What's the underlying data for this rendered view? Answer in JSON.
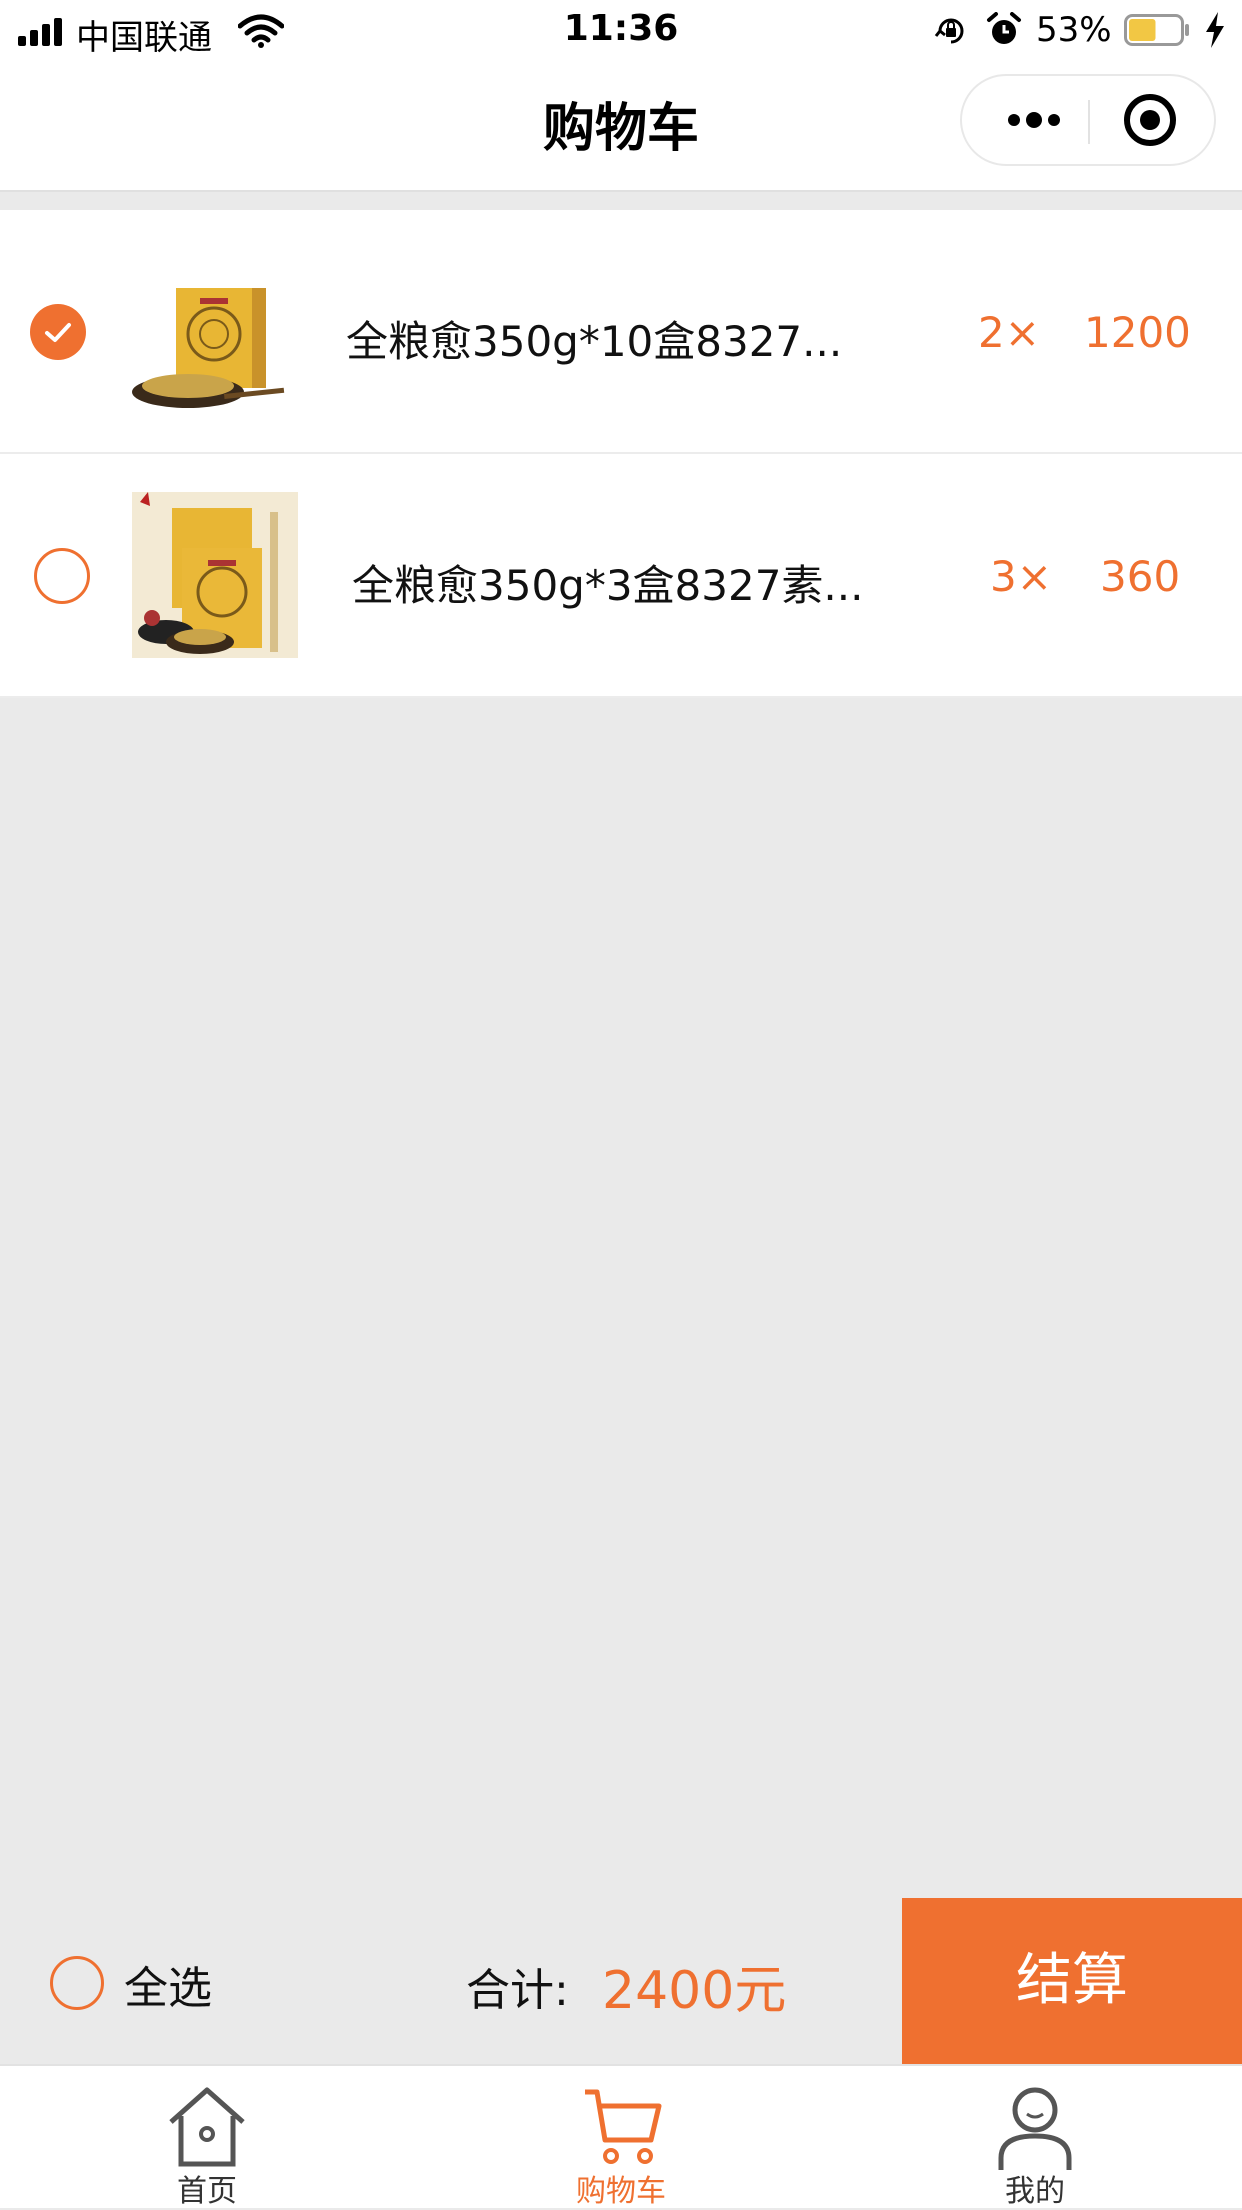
{
  "status_bar": {
    "carrier": "中国联通",
    "time": "11:36",
    "battery_percent": "53%",
    "battery_level": 0.53,
    "icons": [
      "signal-icon",
      "wifi-icon",
      "orientation-lock-icon",
      "alarm-icon",
      "battery-icon",
      "charging-icon"
    ]
  },
  "nav": {
    "title": "购物车",
    "icons": [
      "more-dots-icon",
      "close-target-icon"
    ]
  },
  "cart": {
    "items": [
      {
        "name": "全粮愈350g*10盒8327...",
        "qty": "2×",
        "price": "1200",
        "checked": true
      },
      {
        "name": "全粮愈350g*3盒8327素...",
        "qty": "3×",
        "price": "360",
        "checked": false
      }
    ]
  },
  "checkout": {
    "select_all_label": "全选",
    "total_label": "合计:",
    "total_value": "2400元",
    "checkout_button": "结算"
  },
  "tabs": [
    {
      "label": "首页",
      "icon": "home-icon",
      "active": false
    },
    {
      "label": "购物车",
      "icon": "cart-icon",
      "active": true
    },
    {
      "label": "我的",
      "icon": "user-icon",
      "active": false
    }
  ],
  "colors": {
    "accent": "#ef7030",
    "background": "#eaeaea",
    "surface": "#ffffff"
  }
}
